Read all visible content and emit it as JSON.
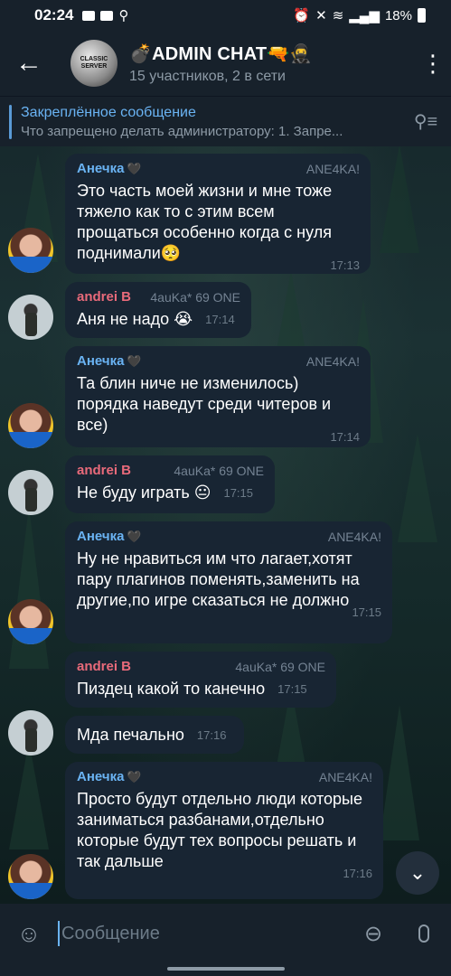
{
  "status_bar": {
    "time": "02:24",
    "battery": "18%"
  },
  "header": {
    "title": "💣ADMIN CHAT🔫🥷",
    "subtitle": "15 участников, 2 в сети",
    "avatar_text": "CLASSIC SERVER"
  },
  "pinned": {
    "title": "Закреплённое сообщение",
    "text": "Что запрещено делать администратору:  1. Запре..."
  },
  "messages": [
    {
      "sender": "Анечка",
      "tag": "ANE4KA!",
      "text": "Это часть моей жизни и мне тоже тяжело как то с этим всем прощаться особенно когда с нуля поднимали🥺",
      "time": "17:13"
    },
    {
      "sender": "andrei B",
      "tag": "4auKa* 69 ONE",
      "text": "Аня не надо 😭",
      "time": "17:14"
    },
    {
      "sender": "Анечка",
      "tag": "ANE4KA!",
      "text": "Та блин ниче не изменилось) порядка наведут среди читеров и все)",
      "time": "17:14"
    },
    {
      "sender": "andrei B",
      "tag": "4auKa* 69 ONE",
      "text": "Не буду играть 😐",
      "time": "17:15"
    },
    {
      "sender": "Анечка",
      "tag": "ANE4KA!",
      "text": "Ну не нравиться им что лагает,хотят пару плагинов поменять,заменить на другие,по игре сказаться не должно",
      "time": "17:15"
    },
    {
      "sender": "andrei B",
      "tag": "4auKa* 69 ONE",
      "text": "Пиздец какой то канечно",
      "time": "17:15"
    },
    {
      "sender": "",
      "tag": "",
      "text": "Мда печально",
      "time": "17:16"
    },
    {
      "sender": "Анечка",
      "tag": "ANE4KA!",
      "text": "Просто будут отдельно люди которые заниматься разбанами,отдельно которые будут тех вопросы решать и так дальше",
      "time": "17:16"
    }
  ],
  "input": {
    "placeholder": "Сообщение"
  },
  "icons": {
    "back": "arrow-left-icon",
    "menu": "more-vertical-icon",
    "unpin": "pin-list-icon",
    "emoji": "emoji-icon",
    "attach": "paperclip-icon",
    "mic": "microphone-icon",
    "scroll": "chevron-down-icon"
  },
  "colors": {
    "bubble": "#182533",
    "header": "#17212b",
    "accent": "#6ab3f3",
    "andrei_name": "#e96a7a"
  }
}
